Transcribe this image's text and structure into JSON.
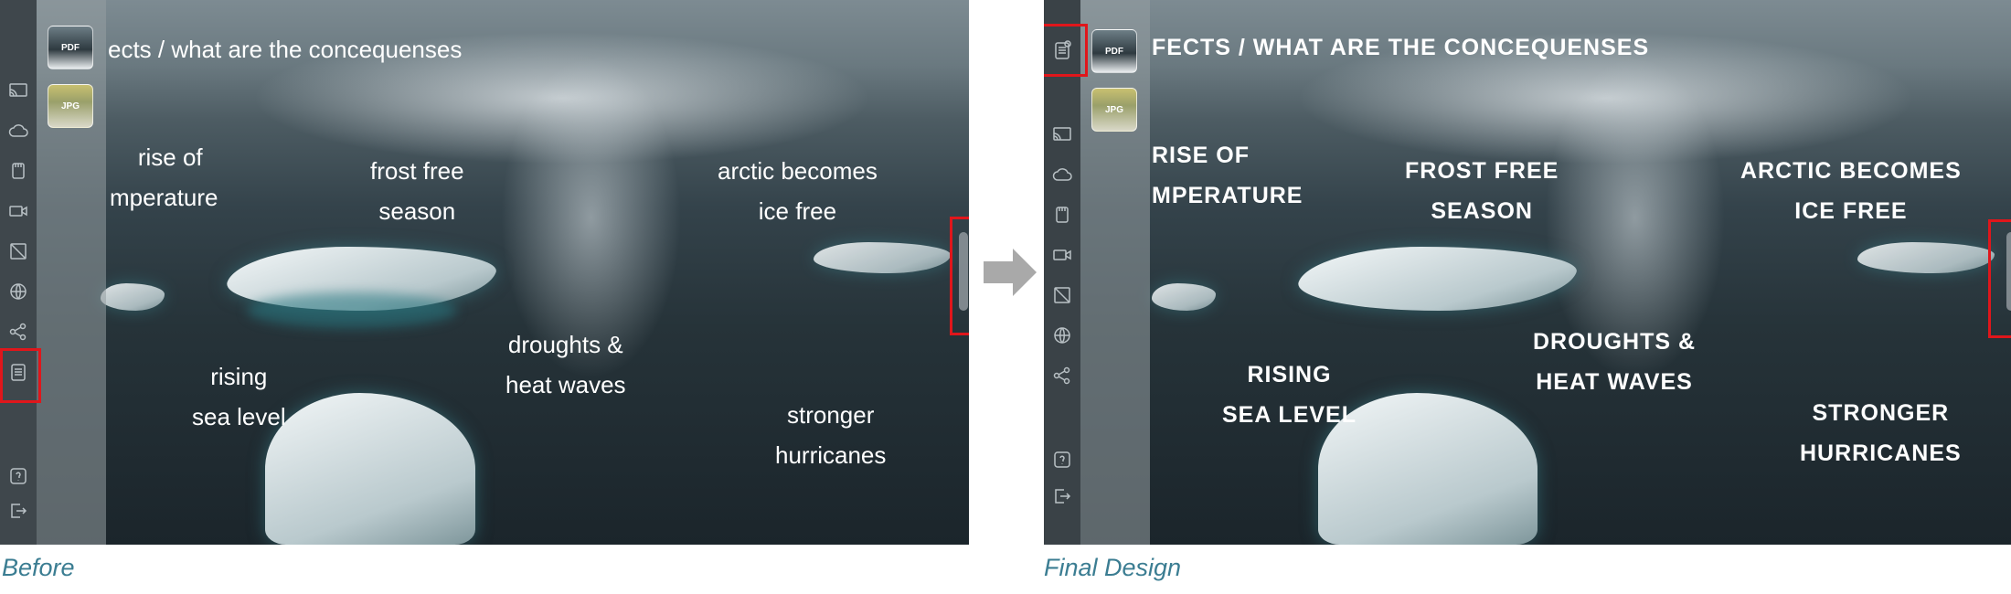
{
  "before": {
    "title": "ects / what are the concequenses",
    "files": [
      {
        "label": "PDF"
      },
      {
        "label": "JPG"
      }
    ],
    "labels": {
      "rise": [
        "rise of",
        "mperature"
      ],
      "frost": [
        "frost free",
        "season"
      ],
      "arctic": [
        "arctic becomes",
        "ice free"
      ],
      "droughts": [
        "droughts &",
        "heat waves"
      ],
      "rising": [
        "rising",
        "sea level"
      ],
      "hurricanes": [
        "stronger",
        "hurricanes"
      ]
    },
    "caption": "Before"
  },
  "final": {
    "title": "FECTS / WHAT ARE THE CONCEQUENSES",
    "files": [
      {
        "label": "PDF"
      },
      {
        "label": "JPG"
      }
    ],
    "labels": {
      "rise": [
        "RISE OF",
        "MPERATURE"
      ],
      "frost": [
        "FROST FREE",
        "SEASON"
      ],
      "arctic": [
        "ARCTIC BECOMES",
        "ICE FREE"
      ],
      "droughts": [
        "DROUGHTS &",
        "HEAT WAVES"
      ],
      "rising": [
        "RISING",
        "SEA LEVEL"
      ],
      "hurricanes": [
        "STRONGER",
        "HURRICANES"
      ]
    },
    "caption": "Final Design"
  },
  "icons": [
    "cast-icon",
    "cloud-icon",
    "storage-icon",
    "video-icon",
    "no-image-icon",
    "globe-icon",
    "share-icon",
    "notes-icon",
    "help-icon",
    "logout-icon"
  ],
  "colors": {
    "highlight": "#e0161b",
    "caption": "#3b7d92",
    "arrow": "#a9a9a9"
  }
}
